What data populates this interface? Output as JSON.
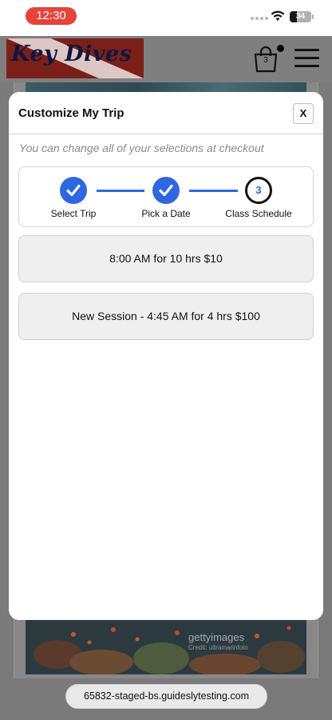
{
  "status_bar": {
    "time": "12:30",
    "battery_level": "34",
    "battery_fraction": 0.34,
    "icons": [
      "cellular-signal-icon",
      "wifi-icon",
      "battery-icon"
    ]
  },
  "site_header": {
    "logo_text": "Key Dives",
    "cart_count": "3",
    "icons": [
      "shopping-bag-icon",
      "hamburger-menu-icon"
    ]
  },
  "hero": {
    "watermark": "gettyimages",
    "watermark_credit": "Credit: ultramarinfoto"
  },
  "modal": {
    "title": "Customize My Trip",
    "close_label": "X",
    "subtitle": "You can change all of your selections at checkout",
    "steps": [
      {
        "label": "Select Trip",
        "status": "complete"
      },
      {
        "label": "Pick a Date",
        "status": "complete"
      },
      {
        "label": "Class Schedule",
        "status": "current",
        "number": "3"
      }
    ],
    "sessions": [
      {
        "label": "8:00 AM for 10 hrs $10"
      },
      {
        "label": "New Session - 4:45 AM for 4 hrs $100"
      }
    ]
  },
  "browser": {
    "url": "65832-staged-bs.guideslytesting.com"
  },
  "colors": {
    "accent": "#2f67e0",
    "time_pill": "#e5443b",
    "logo_banner": "#c0392b",
    "overlay": "#7a7a7a",
    "session_bg": "#efefef"
  }
}
